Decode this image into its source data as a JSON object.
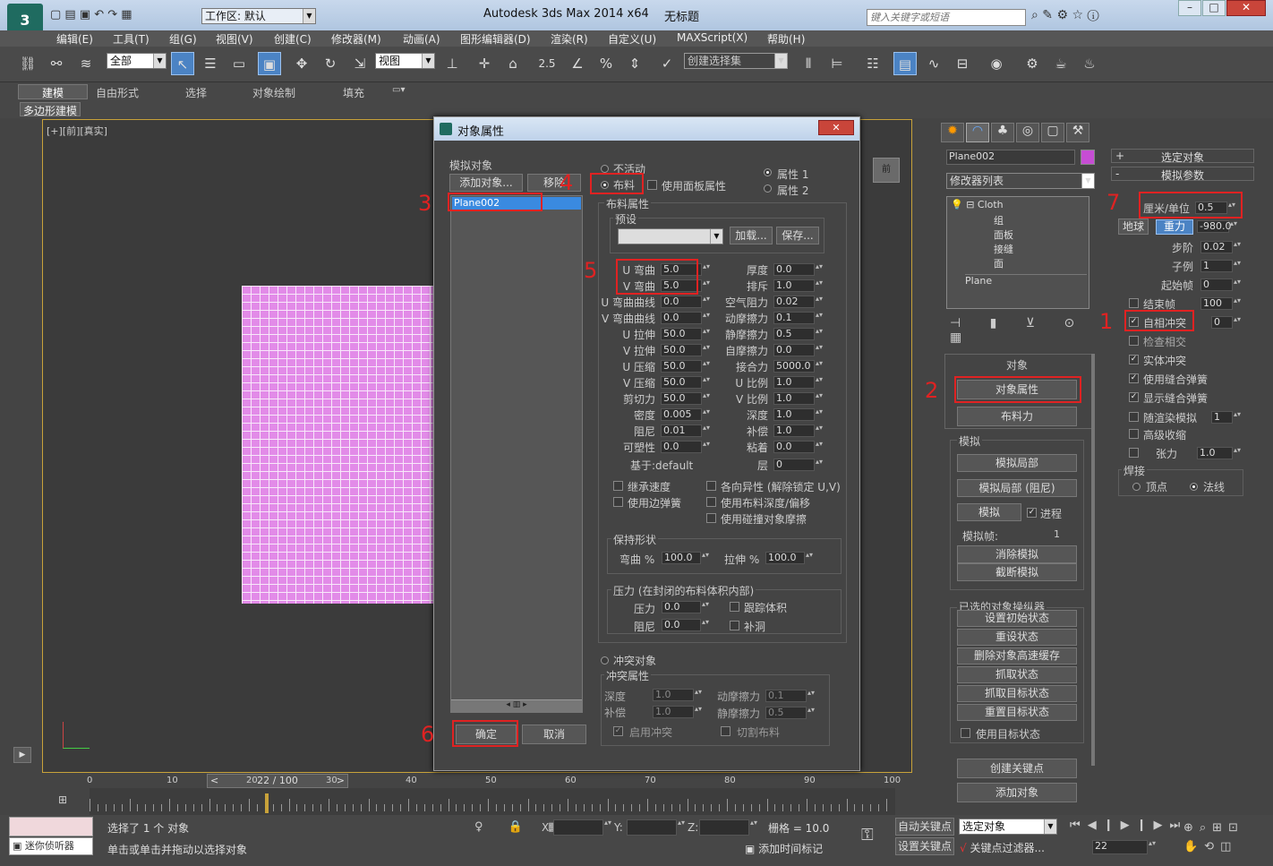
{
  "titlebar": {
    "app_title": "Autodesk 3ds Max  2014 x64",
    "doc_title": "无标题",
    "workspace": "工作区: 默认",
    "search_placeholder": "键入关键字或短语"
  },
  "menu": [
    "编辑(E)",
    "工具(T)",
    "组(G)",
    "视图(V)",
    "创建(C)",
    "修改器(M)",
    "动画(A)",
    "图形编辑器(D)",
    "渲染(R)",
    "自定义(U)",
    "MAXScript(X)",
    "帮助(H)"
  ],
  "toolbar": {
    "filter": "全部",
    "ref_coord": "视图",
    "selection_set": "创建选择集",
    "snap_num": "2.5"
  },
  "ribbon": {
    "tabs": [
      "建模",
      "自由形式",
      "选择",
      "对象绘制",
      "填充"
    ],
    "sub": "多边形建模"
  },
  "viewport": {
    "label": "[+][前][真实]",
    "cube": "前"
  },
  "dialog": {
    "title": "对象属性",
    "sim_objects_label": "模拟对象",
    "add_btn": "添加对象...",
    "remove_btn": "移除",
    "list_item": "Plane002",
    "radio_inactive": "不活动",
    "radio_cloth": "布料",
    "use_panel_props": "使用面板属性",
    "prop1": "属性 1",
    "prop2": "属性 2",
    "cloth_props": "布料属性",
    "preset": "预设",
    "load_btn": "加载...",
    "save_btn": "保存...",
    "params_left": [
      {
        "label": "U 弯曲",
        "value": "5.0"
      },
      {
        "label": "V 弯曲",
        "value": "5.0"
      },
      {
        "label": "U 弯曲曲线",
        "value": "0.0"
      },
      {
        "label": "V 弯曲曲线",
        "value": "0.0"
      },
      {
        "label": "U 拉伸",
        "value": "50.0"
      },
      {
        "label": "V 拉伸",
        "value": "50.0"
      },
      {
        "label": "U 压缩",
        "value": "50.0"
      },
      {
        "label": "V 压缩",
        "value": "50.0"
      },
      {
        "label": "剪切力",
        "value": "50.0"
      },
      {
        "label": "密度",
        "value": "0.005"
      },
      {
        "label": "阻尼",
        "value": "0.01"
      },
      {
        "label": "可塑性",
        "value": "0.0"
      }
    ],
    "params_right": [
      {
        "label": "厚度",
        "value": "0.0"
      },
      {
        "label": "排斥",
        "value": "1.0"
      },
      {
        "label": "空气阻力",
        "value": "0.02"
      },
      {
        "label": "动摩擦力",
        "value": "0.1"
      },
      {
        "label": "静摩擦力",
        "value": "0.5"
      },
      {
        "label": "自摩擦力",
        "value": "0.0"
      },
      {
        "label": "接合力",
        "value": "5000.0"
      },
      {
        "label": "U 比例",
        "value": "1.0"
      },
      {
        "label": "V 比例",
        "value": "1.0"
      },
      {
        "label": "深度",
        "value": "1.0"
      },
      {
        "label": "补偿",
        "value": "1.0"
      },
      {
        "label": "粘着",
        "value": "0.0"
      }
    ],
    "based_on": "基于:default",
    "layer_label": "层",
    "layer_value": "0",
    "chk_inherit": "继承速度",
    "chk_edge": "使用边弹簧",
    "chk_aniso": "各向异性 (解除锁定 U,V)",
    "chk_depth": "使用布料深度/偏移",
    "chk_collfric": "使用碰撞对象摩擦",
    "keep_shape": "保持形状",
    "ks_bend": "弯曲 %",
    "ks_bend_v": "100.0",
    "ks_stretch": "拉伸 %",
    "ks_stretch_v": "100.0",
    "pressure_group": "压力 (在封闭的布料体积内部)",
    "pressure": "压力",
    "pressure_v": "0.0",
    "damp": "阻尼",
    "damp_v": "0.0",
    "track_vol": "跟踪体积",
    "cap_holes": "补洞",
    "collision_obj": "冲突对象",
    "coll_props": "冲突属性",
    "c_depth": "深度",
    "c_depth_v": "1.0",
    "c_offset": "补偿",
    "c_offset_v": "1.0",
    "c_dyn": "动摩擦力",
    "c_dyn_v": "0.1",
    "c_static": "静摩擦力",
    "c_static_v": "0.5",
    "enable_coll": "启用冲突",
    "cut_cloth": "切割布料",
    "ok": "确定",
    "cancel": "取消"
  },
  "cmdpanel": {
    "obj_name": "Plane002",
    "obj_color": "#c64dd4",
    "modlist": "修改器列表",
    "stack": [
      "Cloth",
      "组",
      "面板",
      "接缝",
      "面",
      "Plane"
    ],
    "object_rollout": "对象",
    "btn_objprops": "对象属性",
    "btn_cloth": "布料力",
    "sim_group": "模拟",
    "btn_simlocal": "模拟局部",
    "btn_simlocal_d": "模拟局部 (阻尼)",
    "btn_sim": "模拟",
    "progress": "进程",
    "sim_frame": "模拟帧:",
    "sim_frame_v": "1",
    "btn_erase": "消除模拟",
    "btn_truncate": "截断模拟",
    "sel_manip": "已选的对象操纵器",
    "manip_btns": [
      "设置初始状态",
      "重设状态",
      "删除对象高速缓存",
      "抓取状态",
      "抓取目标状态",
      "重置目标状态"
    ],
    "use_target": "使用目标状态",
    "btn_createkey": "创建关键点",
    "btn_addobj": "添加对象"
  },
  "rpanel": {
    "sel_obj": "选定对象",
    "sim_params": "模拟参数",
    "cm_unit": "厘米/单位",
    "cm_unit_v": "0.5",
    "earth": "地球",
    "gravity": "重力",
    "gravity_v": "-980.0",
    "step": "步阶",
    "step_v": "0.02",
    "sub": "子例",
    "sub_v": "1",
    "start": "起始帧",
    "start_v": "0",
    "end": "结束帧",
    "end_v": "100",
    "self_coll": "自相冲突",
    "self_coll_v": "0",
    "check_inter": "检查相交",
    "solid_coll": "实体冲突",
    "use_sew": "使用缝合弹簧",
    "show_sew": "显示缝合弹簧",
    "render_sim": "随渲染模拟",
    "render_sim_v": "1",
    "adv_pinch": "高级收缩",
    "tension": "张力",
    "tension_v": "1.0",
    "weld": "焊接",
    "vertex": "顶点",
    "normals": "法线"
  },
  "annotations": [
    "1",
    "2",
    "3",
    "4",
    "5",
    "6",
    "7"
  ],
  "timeline": {
    "frame": "22 / 100",
    "ticks": [
      "0",
      "10",
      "20",
      "30",
      "40",
      "50",
      "60",
      "70",
      "80",
      "90",
      "100"
    ]
  },
  "status": {
    "selected": "选择了 1 个 对象",
    "hint": "单击或单击并拖动以选择对象",
    "listener": "迷你侦听器",
    "grid": "栅格 = 10.0",
    "autokey": "自动关键点",
    "setkey": "设置关键点",
    "sel_combo": "选定对象",
    "keyfilter": "关键点过滤器...",
    "add_time": "添加时间标记",
    "cur_frame": "22",
    "x": "X:",
    "y": "Y:",
    "z": "Z:"
  }
}
